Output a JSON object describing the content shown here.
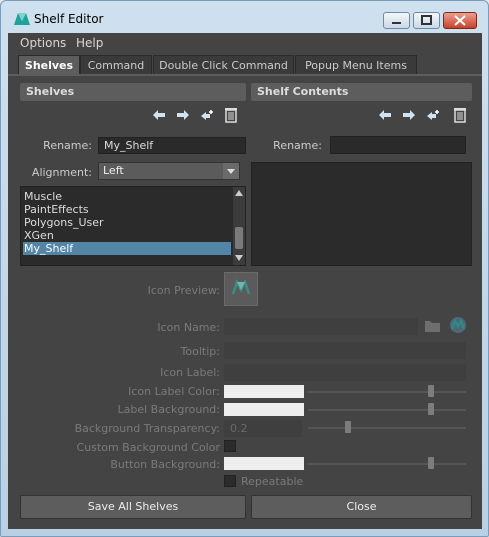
{
  "window": {
    "title": "Shelf Editor"
  },
  "menu": {
    "options": "Options",
    "help": "Help"
  },
  "tabs": {
    "shelves": "Shelves",
    "command": "Command",
    "double_click": "Double Click Command",
    "popup": "Popup Menu Items"
  },
  "shelves_panel": {
    "header": "Shelves",
    "rename_label": "Rename:",
    "rename_value": "My_Shelf",
    "alignment_label": "Alignment:",
    "alignment_value": "Left",
    "items": [
      "Muscle",
      "PaintEffects",
      "Polygons_User",
      "XGen",
      "My_Shelf"
    ],
    "selected_index": 4
  },
  "contents_panel": {
    "header": "Shelf Contents",
    "rename_label": "Rename:",
    "rename_value": ""
  },
  "properties": {
    "icon_preview": "Icon Preview:",
    "icon_name": "Icon Name:",
    "tooltip": "Tooltip:",
    "icon_label": "Icon Label:",
    "icon_label_color": "Icon Label Color:",
    "label_background": "Label Background:",
    "background_transparency": "Background Transparency:",
    "transparency_value": "0.2",
    "custom_background_color": "Custom Background Color",
    "button_background": "Button Background:",
    "repeatable": "Repeatable"
  },
  "buttons": {
    "save_all": "Save All Shelves",
    "close": "Close"
  },
  "colors": {
    "accent": "#5285a6",
    "panel": "#444444",
    "header": "#5d5d5d",
    "field": "#2b2b2b"
  }
}
